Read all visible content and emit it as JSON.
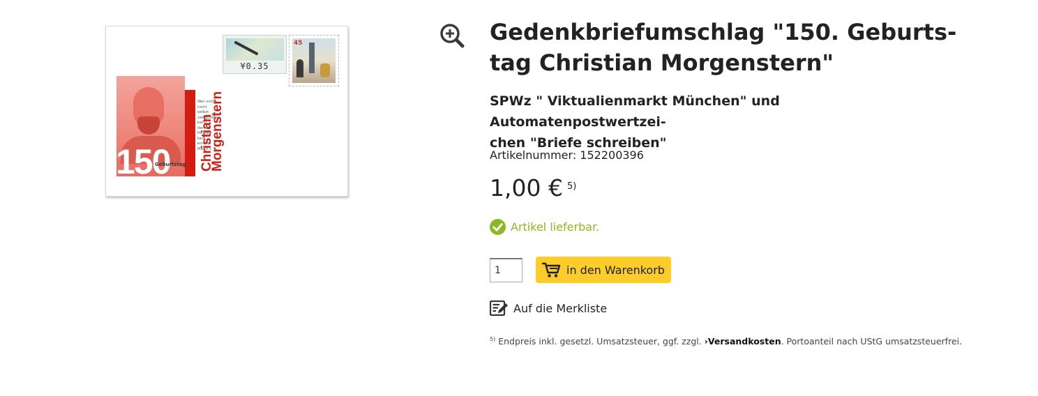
{
  "product": {
    "title": "Gedenkbriefumschlag \"150. Geburts-tag Christian Morgenstern\"",
    "title_line1": "Gedenkbriefumschlag \"150. Geburts-",
    "title_line2": "tag Christian Morgenstern\"",
    "subtitle_line1": "SPWz \" Viktualienmarkt München\" und Automatenpostwertzei-",
    "subtitle_line2": "chen \"Briefe schreiben\"",
    "article_number": "Artikelnummer: 152200396",
    "price": "1,00 €",
    "price_footnote_ref": "5)",
    "availability": "Artikel lieferbar.",
    "quantity": "1"
  },
  "image": {
    "stamp_value": "¥0.35",
    "stamp2_value": "45",
    "big_number": "150",
    "name_line1": "Christian",
    "name_line2": "Morgenstern",
    "geburtstag": "Geburtstag",
    "quote": [
      "Wer sich",
      "nicht",
      "selbst",
      "verspotten",
      "kann,",
      "der ist",
      "fürwahr",
      "kein",
      "ernster",
      "Mann.«"
    ]
  },
  "actions": {
    "cart_label": "in den Warenkorb",
    "wishlist_label": "Auf die Merkliste"
  },
  "footnote": {
    "ref": "5)",
    "text_before": "Endpreis inkl. gesetzl. Umsatzsteuer, ggf. zzgl.",
    "link": "Versandkosten",
    "text_after": ". Portoanteil nach UStG umsatzsteuerfrei."
  },
  "icons": {
    "zoom": "zoom-in-icon",
    "availability": "check-circle-icon",
    "cart": "cart-icon",
    "wishlist": "edit-list-icon"
  },
  "colors": {
    "available_green": "#8cb820",
    "cart_yellow": "#fccc2b",
    "stamp_red": "#d31d12"
  }
}
